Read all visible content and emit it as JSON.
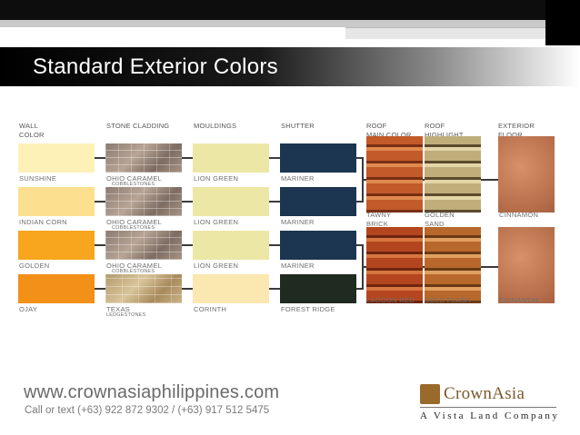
{
  "title": "Standard Exterior Colors",
  "headers": {
    "wall": "WALL\nCOLOR",
    "stone": "STONE CLADDING",
    "mouldings": "MOULDINGS",
    "shutter": "SHUTTER",
    "roof_main": "ROOF\nMAIN COLOR",
    "roof_high": "ROOF\nHIGHLIGHT",
    "floor": "EXTERIOR\nFLOOR"
  },
  "rows": [
    {
      "wall": "SUNSHINE",
      "wall_color": "#fdf1b8",
      "stone": "OHIO CARAMEL",
      "stone_sub": "COBBLESTONES",
      "moulding": "LION GREEN",
      "moulding_color": "#ece7a5",
      "shutter": "MARINER",
      "shutter_color": "#1c3550"
    },
    {
      "wall": "INDIAN CORN",
      "wall_color": "#fde08f",
      "stone": "OHIO CARAMEL",
      "stone_sub": "COBBLESTONES",
      "moulding": "LION GREEN",
      "moulding_color": "#ece7a5",
      "shutter": "MARINER",
      "shutter_color": "#1c3550"
    },
    {
      "wall": "GOLDEN",
      "wall_color": "#f7a61e",
      "stone": "OHIO CARAMEL",
      "stone_sub": "COBBLESTONES",
      "moulding": "LION GREEN",
      "moulding_color": "#ece7a5",
      "shutter": "MARINER",
      "shutter_color": "#1c3550"
    },
    {
      "wall": "OJAY",
      "wall_color": "#f29018",
      "stone": "TEXAS",
      "stone_sub": "LEDGESTONES",
      "moulding": "CORINTH",
      "moulding_color": "#fbe7b0",
      "shutter": "FOREST RIDGE",
      "shutter_color": "#1f2a20"
    }
  ],
  "roof_groups": [
    {
      "main": "TAWNY\nBRICK",
      "highlight": "GOLDEN\nSAND",
      "floor": "CINNAMON"
    },
    {
      "main": "LAGOON RED",
      "highlight": "GOLD FLASH",
      "floor": "CINNAMON"
    }
  ],
  "footer": {
    "url": "www.crownasiaphilippines.com",
    "call": "Call or text (+63) 922 872 9302 / (+63) 917 512 5475",
    "logo": "CrownAsia",
    "tagline": "A Vista Land Company"
  },
  "colors": {
    "accent": "#7a5a2a",
    "line": "#3a3a3a"
  }
}
